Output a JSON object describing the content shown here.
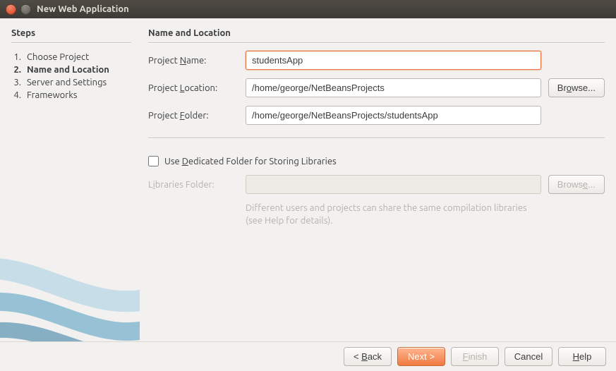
{
  "window": {
    "title": "New Web Application"
  },
  "sidebar": {
    "heading": "Steps",
    "steps": [
      {
        "num": "1.",
        "label": "Choose Project"
      },
      {
        "num": "2.",
        "label": "Name and Location"
      },
      {
        "num": "3.",
        "label": "Server and Settings"
      },
      {
        "num": "4.",
        "label": "Frameworks"
      }
    ],
    "active_index": 1
  },
  "main": {
    "heading": "Name and Location",
    "project_name": {
      "label_pre": "Project ",
      "label_u": "N",
      "label_post": "ame:",
      "value": "studentsApp"
    },
    "project_location": {
      "label_pre": "Project ",
      "label_u": "L",
      "label_post": "ocation:",
      "value": "/home/george/NetBeansProjects",
      "browse_pre": "Br",
      "browse_u": "o",
      "browse_post": "wse..."
    },
    "project_folder": {
      "label_pre": "Project ",
      "label_u": "F",
      "label_post": "older:",
      "value": "/home/george/NetBeansProjects/studentsApp"
    },
    "dedicated": {
      "checked": false,
      "label_pre": "Use ",
      "label_u": "D",
      "label_post": "edicated Folder for Storing Libraries"
    },
    "libraries_folder": {
      "label_pre": "L",
      "label_u": "i",
      "label_post": "braries Folder:",
      "value": "",
      "browse_pre": "Brows",
      "browse_u": "e",
      "browse_post": "..."
    },
    "hint": "Different users and projects can share the same compilation libraries (see Help for details)."
  },
  "footer": {
    "back": {
      "pre": "< ",
      "u": "B",
      "post": "ack"
    },
    "next": {
      "label": "Next >"
    },
    "finish": {
      "u": "F",
      "post": "inish"
    },
    "cancel": {
      "label": "Cancel"
    },
    "help": {
      "u": "H",
      "post": "elp"
    }
  }
}
